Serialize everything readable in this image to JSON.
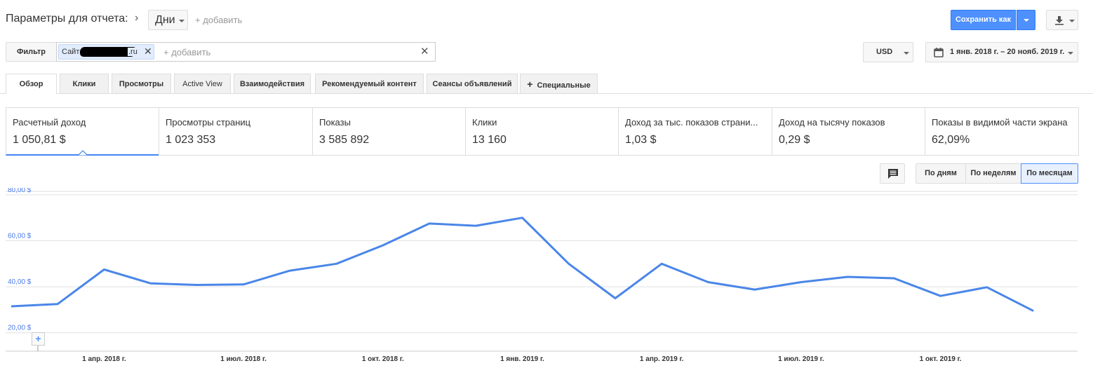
{
  "header": {
    "params_label": "Параметры для отчета:",
    "dimension": "Дни",
    "add_dimension": "+ добавить",
    "save_as": "Сохранить как"
  },
  "filter": {
    "button": "Фильтр",
    "chip_label": "Сайт",
    "chip_suffix": ".ru",
    "add_filter": "+ добавить",
    "currency": "USD",
    "date_range": "1 янв. 2018 г. – 20 нояб. 2019 г."
  },
  "tabs": [
    "Обзор",
    "Клики",
    "Просмотры",
    "Active View",
    "Взаимодействия",
    "Рекомендуемый контент",
    "Сеансы объявлений",
    "Специальные"
  ],
  "metrics": [
    {
      "title": "Расчетный доход",
      "value": "1 050,81 $"
    },
    {
      "title": "Просмотры страниц",
      "value": "1 023 353"
    },
    {
      "title": "Показы",
      "value": "3 585 892"
    },
    {
      "title": "Клики",
      "value": "13 160"
    },
    {
      "title": "Доход за тыс. показов страни...",
      "value": "1,03 $"
    },
    {
      "title": "Доход на тысячу показов",
      "value": "0,29 $"
    },
    {
      "title": "Показы в видимой части экрана",
      "value": "62,09%"
    }
  ],
  "granularity": {
    "days": "По дням",
    "weeks": "По неделям",
    "months": "По месяцам"
  },
  "expand_symbol": "+",
  "colors": {
    "accent": "#4285f4",
    "line": "#4a86e8",
    "button_blue": "#4d90fe"
  },
  "icons": [
    "chevron-right-icon",
    "caret-down-icon",
    "download-icon",
    "close-icon",
    "calendar-icon",
    "plus-icon",
    "comment-icon"
  ],
  "chart_data": {
    "type": "line",
    "y_tick_labels": [
      "80,00 $",
      "60,00 $",
      "40,00 $",
      "20,00 $"
    ],
    "y_ticks": [
      80,
      60,
      40,
      20
    ],
    "ylim": [
      12,
      83
    ],
    "x_tick_labels": [
      "1 апр. 2018 г.",
      "1 июл. 2018 г.",
      "1 окт. 2018 г.",
      "1 янв. 2019 г.",
      "1 апр. 2019 г.",
      "1 июл. 2019 г.",
      "1 окт. 2019 г."
    ],
    "x_tick_positions": [
      2,
      5,
      8,
      11,
      14,
      17,
      20
    ],
    "x_range": [
      -0.12,
      22.95
    ],
    "grid": true,
    "series": [
      {
        "values": [
          31.5,
          32.5,
          47.5,
          41.5,
          40.8,
          41,
          47,
          50,
          58,
          67.5,
          66.5,
          70,
          50,
          35,
          50,
          42,
          38.8,
          42,
          44.3,
          43.7,
          36,
          39.8,
          29.5
        ]
      }
    ]
  }
}
